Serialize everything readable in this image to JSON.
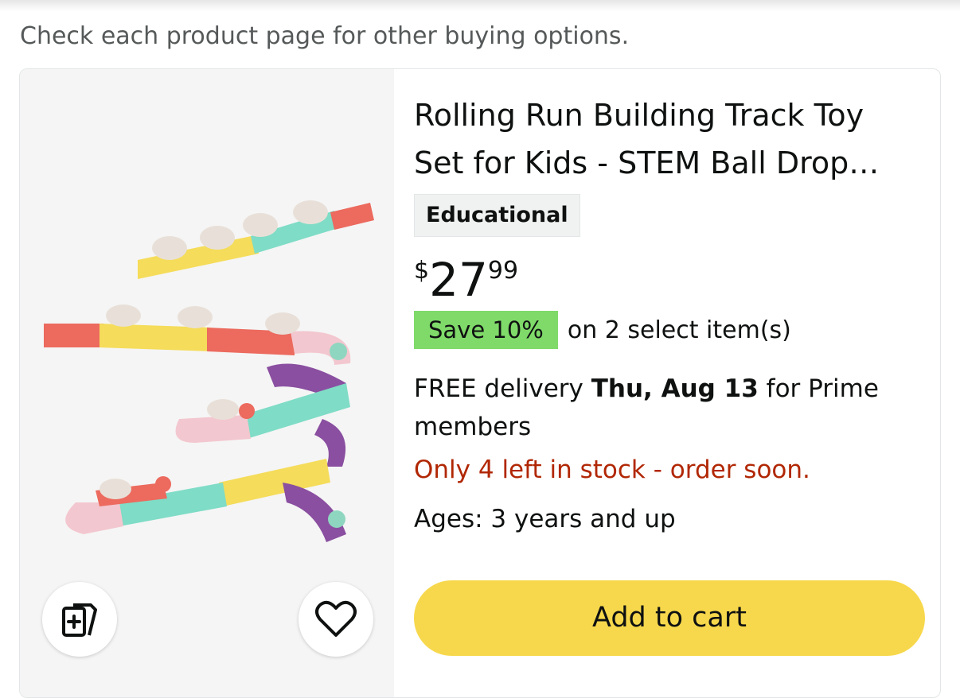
{
  "notice": "Check each product page for other buying options.",
  "product": {
    "title": "Rolling Run Building Track Toy Set for Kids - STEM Ball Drop Race Track Toy",
    "badge": "Educational",
    "price": {
      "symbol": "$",
      "whole": "27",
      "fraction": "99"
    },
    "save_badge": "Save 10%",
    "save_text": "on 2 select item(s)",
    "delivery_prefix": "FREE delivery ",
    "delivery_date": "Thu, Aug 13",
    "delivery_suffix": " for Prime members",
    "stock": "Only 4 left in stock - order soon.",
    "ages": "Ages: 3 years and up",
    "cart_button": "Add to cart"
  },
  "icons": {
    "compare": "compare-cards-icon",
    "favorite": "heart-icon"
  },
  "colors": {
    "price_text": "#0f1111",
    "save_badge": "#7fda69",
    "stock_text": "#b12704",
    "cart_button": "#f7d84c",
    "track_yellow": "#f5dc5a",
    "track_teal": "#7fdcc6",
    "track_coral": "#ec6a5e",
    "track_pink": "#f3c7cf",
    "track_purple": "#8a4fa0"
  }
}
